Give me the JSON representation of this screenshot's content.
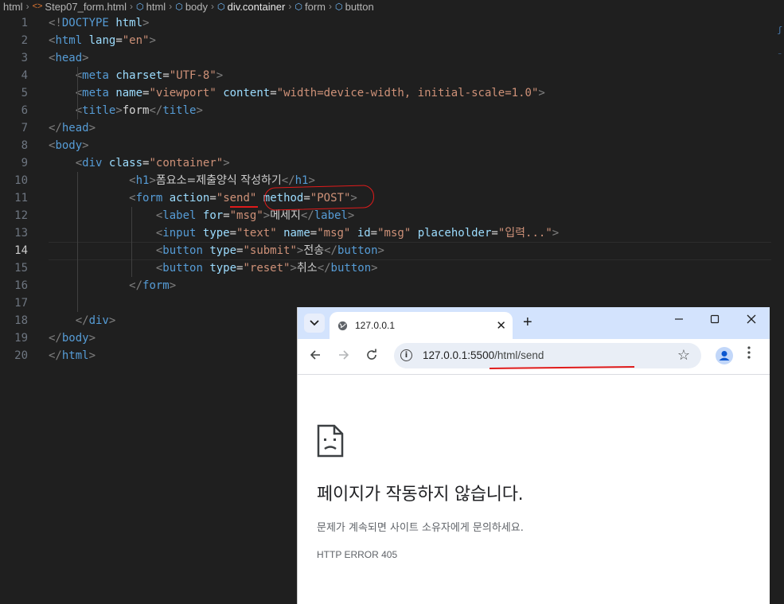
{
  "breadcrumb": [
    {
      "label": "html",
      "kind": "folder"
    },
    {
      "label": "Step07_form.html",
      "kind": "file",
      "icon": "html-file-icon"
    },
    {
      "label": "html",
      "kind": "symbol"
    },
    {
      "label": "body",
      "kind": "symbol"
    },
    {
      "label": "div.container",
      "kind": "symbol"
    },
    {
      "label": "form",
      "kind": "symbol"
    },
    {
      "label": "button",
      "kind": "symbol"
    }
  ],
  "editor": {
    "current_line": 14,
    "lines": [
      {
        "n": "1",
        "t": [
          [
            "br",
            "<!"
          ],
          [
            "tag",
            "DOCTYPE"
          ],
          [
            "txt",
            " "
          ],
          [
            "attr",
            "html"
          ],
          [
            "br",
            ">"
          ]
        ]
      },
      {
        "n": "2",
        "t": [
          [
            "br",
            "<"
          ],
          [
            "tag",
            "html"
          ],
          [
            "txt",
            " "
          ],
          [
            "attr",
            "lang"
          ],
          [
            "txt",
            "="
          ],
          [
            "str",
            "\"en\""
          ],
          [
            "br",
            ">"
          ]
        ]
      },
      {
        "n": "3",
        "t": [
          [
            "br",
            "<"
          ],
          [
            "tag",
            "head"
          ],
          [
            "br",
            ">"
          ]
        ]
      },
      {
        "n": "4",
        "t": [
          [
            "txt",
            "    "
          ],
          [
            "br",
            "<"
          ],
          [
            "tag",
            "meta"
          ],
          [
            "txt",
            " "
          ],
          [
            "attr",
            "charset"
          ],
          [
            "txt",
            "="
          ],
          [
            "str",
            "\"UTF-8\""
          ],
          [
            "br",
            ">"
          ]
        ]
      },
      {
        "n": "5",
        "t": [
          [
            "txt",
            "    "
          ],
          [
            "br",
            "<"
          ],
          [
            "tag",
            "meta"
          ],
          [
            "txt",
            " "
          ],
          [
            "attr",
            "name"
          ],
          [
            "txt",
            "="
          ],
          [
            "str",
            "\"viewport\""
          ],
          [
            "txt",
            " "
          ],
          [
            "attr",
            "content"
          ],
          [
            "txt",
            "="
          ],
          [
            "str",
            "\"width=device-width, initial-scale=1.0\""
          ],
          [
            "br",
            ">"
          ]
        ]
      },
      {
        "n": "6",
        "t": [
          [
            "txt",
            "    "
          ],
          [
            "br",
            "<"
          ],
          [
            "tag",
            "title"
          ],
          [
            "br",
            ">"
          ],
          [
            "txt",
            "form"
          ],
          [
            "br",
            "</"
          ],
          [
            "tag",
            "title"
          ],
          [
            "br",
            ">"
          ]
        ]
      },
      {
        "n": "7",
        "t": [
          [
            "br",
            "</"
          ],
          [
            "tag",
            "head"
          ],
          [
            "br",
            ">"
          ]
        ]
      },
      {
        "n": "8",
        "t": [
          [
            "br",
            "<"
          ],
          [
            "tag",
            "body"
          ],
          [
            "br",
            ">"
          ]
        ]
      },
      {
        "n": "9",
        "t": [
          [
            "txt",
            "    "
          ],
          [
            "br",
            "<"
          ],
          [
            "tag",
            "div"
          ],
          [
            "txt",
            " "
          ],
          [
            "attr",
            "class"
          ],
          [
            "txt",
            "="
          ],
          [
            "str",
            "\"container\""
          ],
          [
            "br",
            ">"
          ]
        ]
      },
      {
        "n": "10",
        "t": [
          [
            "txt",
            "            "
          ],
          [
            "br",
            "<"
          ],
          [
            "tag",
            "h1"
          ],
          [
            "br",
            ">"
          ],
          [
            "kr",
            "폼요소=제출양식 작성하기"
          ],
          [
            "br",
            "</"
          ],
          [
            "tag",
            "h1"
          ],
          [
            "br",
            ">"
          ]
        ]
      },
      {
        "n": "11",
        "t": [
          [
            "txt",
            "            "
          ],
          [
            "br",
            "<"
          ],
          [
            "tag",
            "form"
          ],
          [
            "txt",
            " "
          ],
          [
            "attr",
            "action"
          ],
          [
            "txt",
            "="
          ],
          [
            "str",
            "\"send\""
          ],
          [
            "txt",
            " "
          ],
          [
            "attr",
            "method"
          ],
          [
            "txt",
            "="
          ],
          [
            "str",
            "\"POST\""
          ],
          [
            "br",
            ">"
          ]
        ]
      },
      {
        "n": "12",
        "t": [
          [
            "txt",
            "                "
          ],
          [
            "br",
            "<"
          ],
          [
            "tag",
            "label"
          ],
          [
            "txt",
            " "
          ],
          [
            "attr",
            "for"
          ],
          [
            "txt",
            "="
          ],
          [
            "str",
            "\"msg\""
          ],
          [
            "br",
            ">"
          ],
          [
            "kr",
            "메세지"
          ],
          [
            "br",
            "</"
          ],
          [
            "tag",
            "label"
          ],
          [
            "br",
            ">"
          ]
        ]
      },
      {
        "n": "13",
        "t": [
          [
            "txt",
            "                "
          ],
          [
            "br",
            "<"
          ],
          [
            "tag",
            "input"
          ],
          [
            "txt",
            " "
          ],
          [
            "attr",
            "type"
          ],
          [
            "txt",
            "="
          ],
          [
            "str",
            "\"text\""
          ],
          [
            "txt",
            " "
          ],
          [
            "attr",
            "name"
          ],
          [
            "txt",
            "="
          ],
          [
            "str",
            "\"msg\""
          ],
          [
            "txt",
            " "
          ],
          [
            "attr",
            "id"
          ],
          [
            "txt",
            "="
          ],
          [
            "str",
            "\"msg\""
          ],
          [
            "txt",
            " "
          ],
          [
            "attr",
            "placeholder"
          ],
          [
            "txt",
            "="
          ],
          [
            "str",
            "\"입력...\""
          ],
          [
            "br",
            ">"
          ]
        ]
      },
      {
        "n": "14",
        "t": [
          [
            "txt",
            "                "
          ],
          [
            "br",
            "<"
          ],
          [
            "tag",
            "button"
          ],
          [
            "txt",
            " "
          ],
          [
            "attr",
            "type"
          ],
          [
            "txt",
            "="
          ],
          [
            "str",
            "\"submit\""
          ],
          [
            "br",
            ">"
          ],
          [
            "kr",
            "전송"
          ],
          [
            "br",
            "</"
          ],
          [
            "tag",
            "button"
          ],
          [
            "br",
            ">"
          ]
        ]
      },
      {
        "n": "15",
        "t": [
          [
            "txt",
            "                "
          ],
          [
            "br",
            "<"
          ],
          [
            "tag",
            "button"
          ],
          [
            "txt",
            " "
          ],
          [
            "attr",
            "type"
          ],
          [
            "txt",
            "="
          ],
          [
            "str",
            "\"reset\""
          ],
          [
            "br",
            ">"
          ],
          [
            "kr",
            "취소"
          ],
          [
            "br",
            "</"
          ],
          [
            "tag",
            "button"
          ],
          [
            "br",
            ">"
          ]
        ]
      },
      {
        "n": "16",
        "t": [
          [
            "txt",
            "            "
          ],
          [
            "br",
            "</"
          ],
          [
            "tag",
            "form"
          ],
          [
            "br",
            ">"
          ]
        ]
      },
      {
        "n": "17",
        "t": []
      },
      {
        "n": "18",
        "t": [
          [
            "txt",
            "    "
          ],
          [
            "br",
            "</"
          ],
          [
            "tag",
            "div"
          ],
          [
            "br",
            ">"
          ]
        ]
      },
      {
        "n": "19",
        "t": [
          [
            "br",
            "</"
          ],
          [
            "tag",
            "body"
          ],
          [
            "br",
            ">"
          ]
        ]
      },
      {
        "n": "20",
        "t": [
          [
            "br",
            "</"
          ],
          [
            "tag",
            "html"
          ],
          [
            "br",
            ">"
          ]
        ]
      }
    ]
  },
  "browser": {
    "tab_title": "127.0.0.1",
    "tab_close": "✕",
    "new_tab": "+",
    "url_host": "127.0.0.1:5500",
    "url_path": "/html/send",
    "error_title": "페이지가 작동하지 않습니다.",
    "error_description": "문제가 계속되면 사이트 소유자에게 문의하세요.",
    "error_code": "HTTP ERROR 405"
  },
  "colors": {
    "editor_bg": "#1f1f1f",
    "tag": "#569cd6",
    "attribute": "#9cdcfe",
    "string": "#ce9178",
    "annotation_red": "#e01b1b",
    "browser_tabstrip": "#d3e3fd"
  }
}
